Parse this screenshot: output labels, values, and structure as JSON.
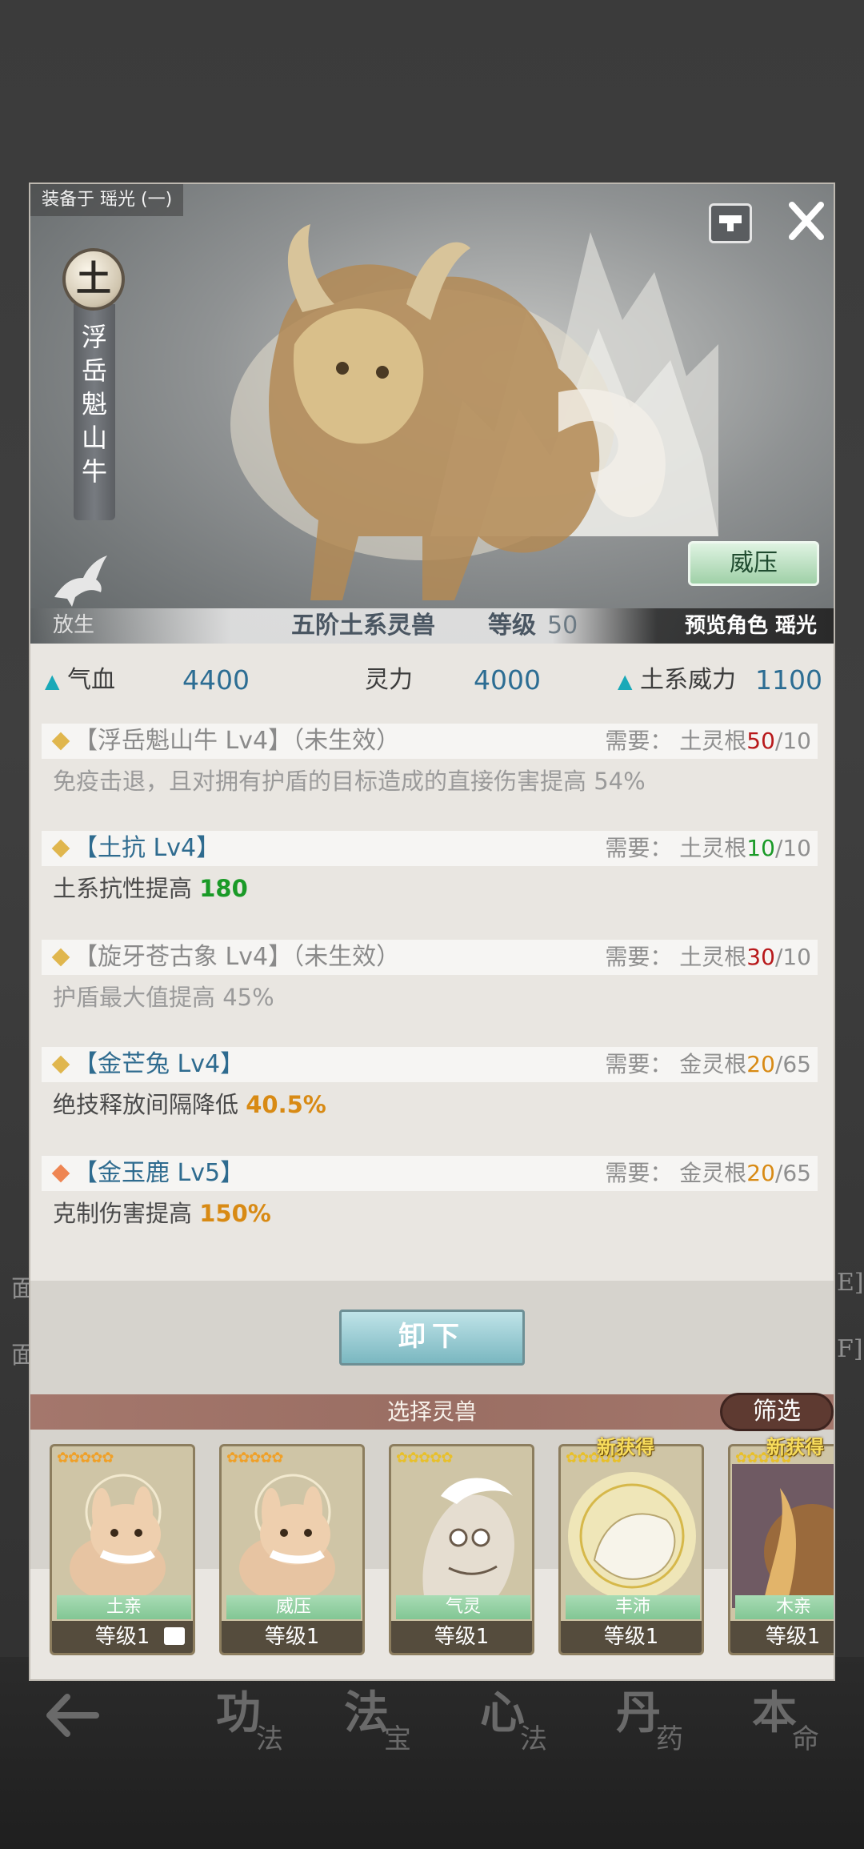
{
  "background": {
    "side_labels": [
      "面",
      "面",
      "E]",
      "F]"
    ],
    "nav": [
      {
        "big": "功",
        "small": "法"
      },
      {
        "big": "法",
        "small": "宝"
      },
      {
        "big": "心",
        "small": "法"
      },
      {
        "big": "丹",
        "small": "药"
      },
      {
        "big": "本",
        "small": "命"
      }
    ]
  },
  "dialog": {
    "equip_label": "装备于 瑶光 (一)",
    "element": "土",
    "beast_name": "浮岳魁山牛",
    "release_label": "放生",
    "skill_button": "威压",
    "tier": "五阶土系灵兽",
    "level_label": "等级",
    "level_value": "50",
    "preview": "预览角色 瑶光",
    "stats": {
      "hp_label": "气血",
      "hp_value": "4400",
      "spirit_label": "灵力",
      "spirit_value": "4000",
      "power_label": "土系威力",
      "power_value": "1100"
    },
    "skills": [
      {
        "title": "【浮岳魁山牛 Lv4】（未生效）",
        "req_prefix": "需要：  土灵根",
        "req_cur": "50",
        "req_max": "/10",
        "desc": "免疫击退，且对拥有护盾的目标造成的直接伤害提高 54%",
        "desc_value": ""
      },
      {
        "title": "【土抗 Lv4】",
        "req_prefix": "需要：  土灵根",
        "req_cur": "10",
        "req_max": "/10",
        "desc": "土系抗性提高 ",
        "desc_value": "180"
      },
      {
        "title": "【旋牙苍古象 Lv4】（未生效）",
        "req_prefix": "需要：  土灵根",
        "req_cur": "30",
        "req_max": "/10",
        "desc": "护盾最大值提高 45%",
        "desc_value": ""
      },
      {
        "title": "【金芒兔 Lv4】",
        "req_prefix": "需要：  金灵根",
        "req_cur": "20",
        "req_max": "/65",
        "desc": "绝技释放间隔降低 ",
        "desc_value": "40.5%"
      },
      {
        "title": "【金玉鹿 Lv5】",
        "req_prefix": "需要：  金灵根",
        "req_cur": "20",
        "req_max": "/65",
        "desc": "克制伤害提高 ",
        "desc_value": "150%"
      }
    ],
    "unequip_button": "卸下",
    "select_title": "选择灵兽",
    "filter_button": "筛选",
    "cards": [
      {
        "tag": "土亲",
        "level": "等级1",
        "new": ""
      },
      {
        "tag": "威压",
        "level": "等级1",
        "new": ""
      },
      {
        "tag": "气灵",
        "level": "等级1",
        "new": ""
      },
      {
        "tag": "丰沛",
        "level": "等级1",
        "new": "新获得"
      },
      {
        "tag": "木亲",
        "level": "等级1",
        "new": "新获得"
      }
    ],
    "colors": {
      "active_title": "#2e6b8f",
      "req_red": "#b8191b",
      "req_green": "#1a9a27",
      "value_orange": "#d88a14",
      "stat_value": "#2c6d93"
    }
  }
}
